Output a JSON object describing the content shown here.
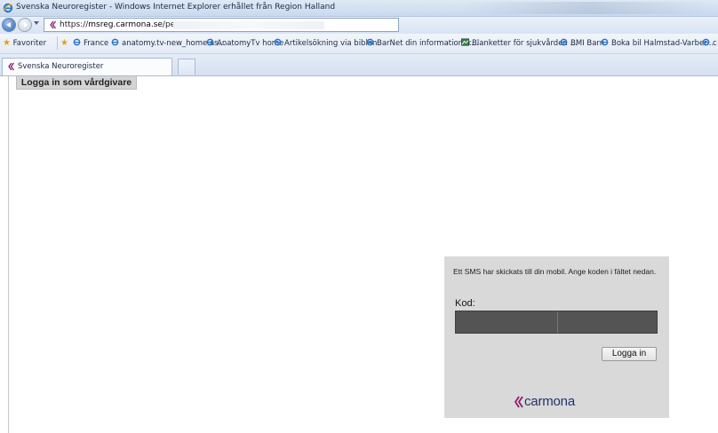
{
  "window": {
    "title": "Svenska Neuroregister - Windows Internet Explorer erhållet från Region Halland"
  },
  "address_bar": {
    "url_prefix": "https://",
    "url_host": "msreg.carmona.se",
    "url_path": "/per"
  },
  "favorites_bar": {
    "label": "Favoriter",
    "items": [
      {
        "label": "France",
        "icon": "ie-icon"
      },
      {
        "label": "anatomy.tv-new_home.as...",
        "icon": "ie-icon"
      },
      {
        "label": "AnatomyTv home",
        "icon": "ie-icon"
      },
      {
        "label": "Artikelsökning via biblan",
        "icon": "ie-icon"
      },
      {
        "label": "BarNet din informationsk...",
        "icon": "ie-icon"
      },
      {
        "label": "Blanketter för sjukvården ...",
        "icon": "image-icon"
      },
      {
        "label": "BMI Barn",
        "icon": "ie-icon"
      },
      {
        "label": "Boka bil Halmstad-Varber...",
        "icon": "ie-icon"
      },
      {
        "label": "c",
        "icon": "ie-icon"
      }
    ]
  },
  "tabs": [
    {
      "label": "Svenska Neuroregister",
      "active": true
    }
  ],
  "page": {
    "vardgivare_button": "Logga in som vårdgivare",
    "login": {
      "message": "Ett SMS har skickats till din mobil. Ange koden i fältet nedan.",
      "code_label": "Kod:",
      "code_value": "",
      "submit_label": "Logga in",
      "brand": "carmona"
    }
  },
  "colors": {
    "brand_text": "#23336b",
    "brand_chevron": "#8a1f6a",
    "panel_bg": "#d9d9d9",
    "input_bg": "#545454"
  }
}
